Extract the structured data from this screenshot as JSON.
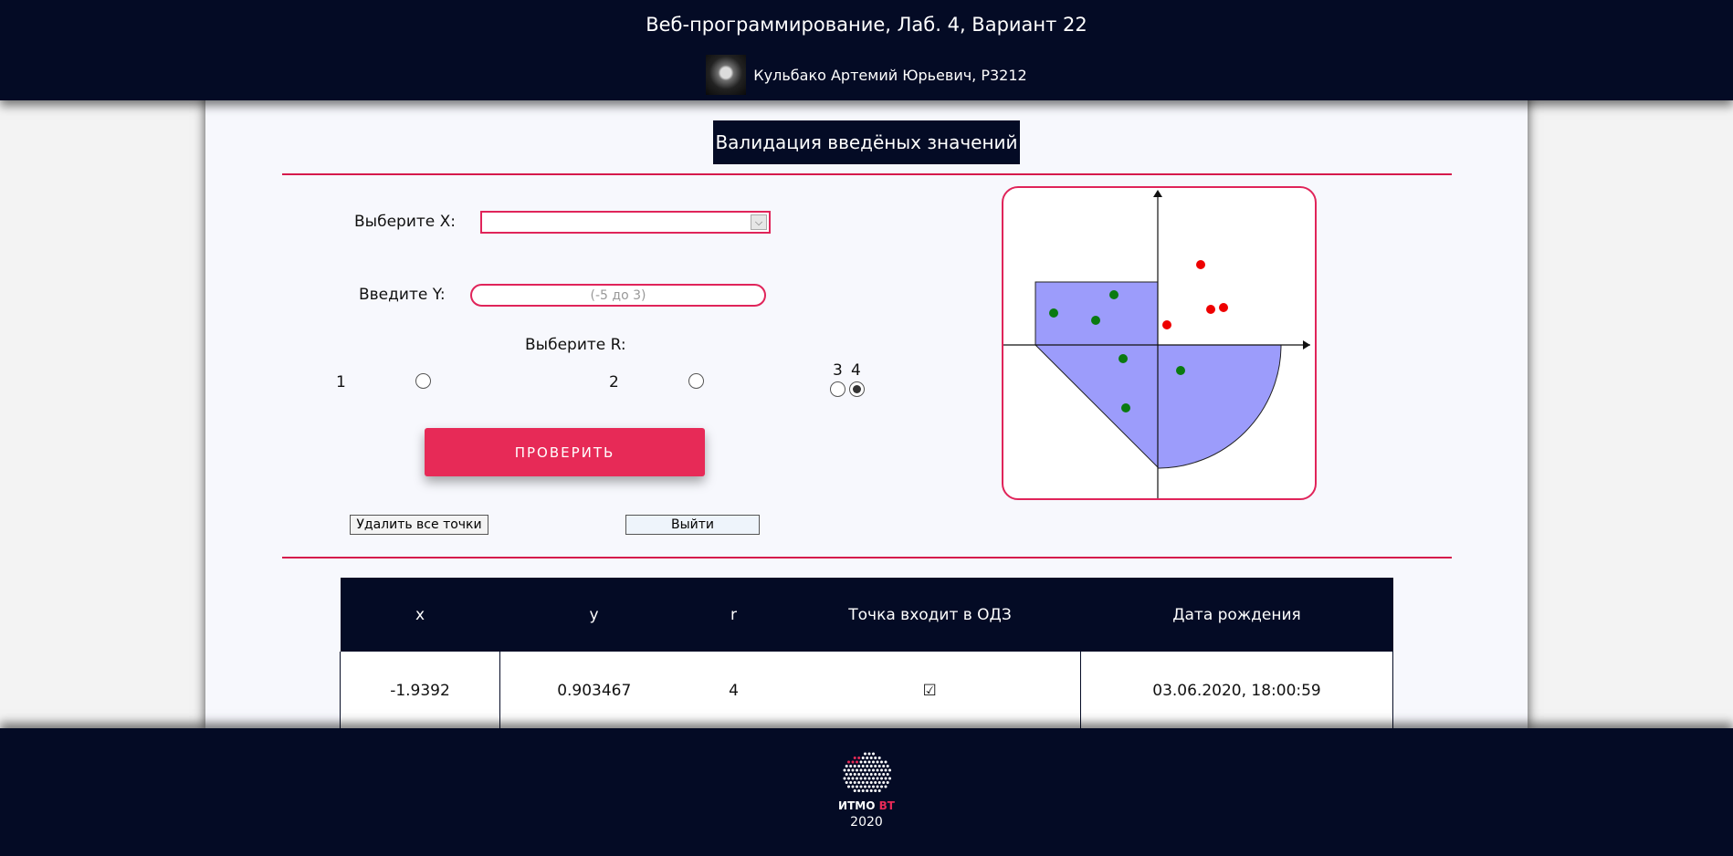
{
  "header": {
    "title": "Веб-программирование, Лаб. 4, Вариант 22",
    "author": "Кульбако Артемий Юрьевич, P3212"
  },
  "form": {
    "section_title": "Валидация введёных значений",
    "x_label": "Выберите X:",
    "x_value": "",
    "y_label": "Введите Y:",
    "y_placeholder": "(-5 до 3)",
    "r_label": "Выберите R:",
    "r_options": [
      {
        "label": "1",
        "checked": false
      },
      {
        "label": "2",
        "checked": false
      },
      {
        "label": "3",
        "checked": false
      },
      {
        "label": "4",
        "checked": true
      }
    ],
    "check_button": "ПРОВЕРИТЬ",
    "delete_button": "Удалить все точки",
    "logout_button": "Выйти"
  },
  "graph": {
    "area_color": "#9c9cfb",
    "hit_color": "#0a7a10",
    "miss_color": "#ee0000"
  },
  "table": {
    "headers": [
      "x",
      "y",
      "r",
      "Точка входит в ОДЗ",
      "Дата рождения"
    ],
    "rows": [
      [
        "-1.9392",
        "0.903467",
        "4",
        "☑",
        "03.06.2020, 18:00:59"
      ]
    ]
  },
  "footer": {
    "logo_text_main": "ИТМО",
    "logo_text_accent": "ВТ",
    "year": "2020"
  },
  "colors": {
    "navy": "#040b25",
    "accent": "#e72a57"
  }
}
